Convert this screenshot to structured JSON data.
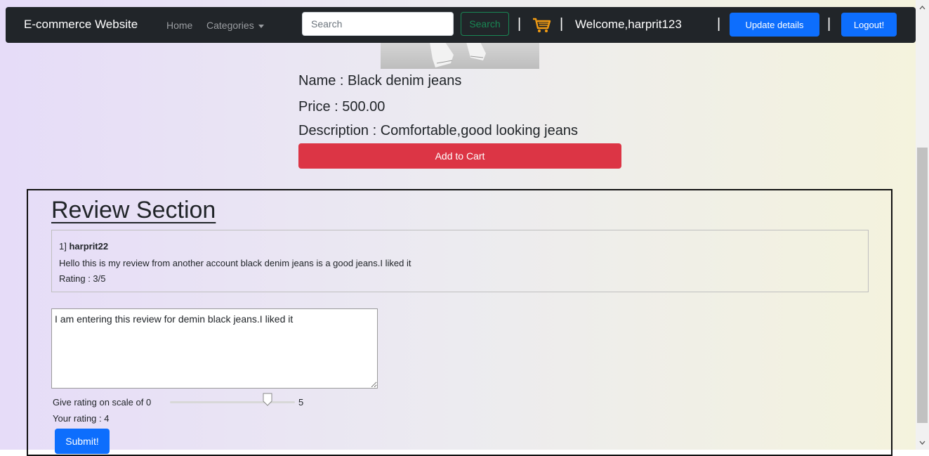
{
  "navbar": {
    "brand": "E-commerce Website",
    "home": "Home",
    "categories": "Categories",
    "search_placeholder": "Search",
    "search_button": "Search",
    "separator": "|",
    "welcome": "Welcome,harprit123",
    "update_button": "Update details",
    "logout_button": "Logout!"
  },
  "product": {
    "name": "Name : Black denim jeans",
    "price": "Price : 500.00",
    "description": "Description : Comfortable,good looking jeans",
    "add_to_cart": "Add to Cart"
  },
  "reviews": {
    "title": "Review Section",
    "items": [
      {
        "index": "1]",
        "user": "harprit22",
        "text": "Hello this is my review from another account black denim jeans is a good jeans.I liked it",
        "rating": "Rating : 3/5"
      }
    ]
  },
  "form": {
    "review_value": "I am entering this review for demin black jeans.I liked it",
    "scale_label": "Give rating on scale of 0",
    "scale_max": "5",
    "slider_value": 4,
    "your_rating": "Your rating : 4",
    "submit": "Submit!"
  },
  "colors": {
    "navbar": "#212529",
    "primary": "#0d6efd",
    "danger": "#dc3545",
    "success": "#198754"
  }
}
